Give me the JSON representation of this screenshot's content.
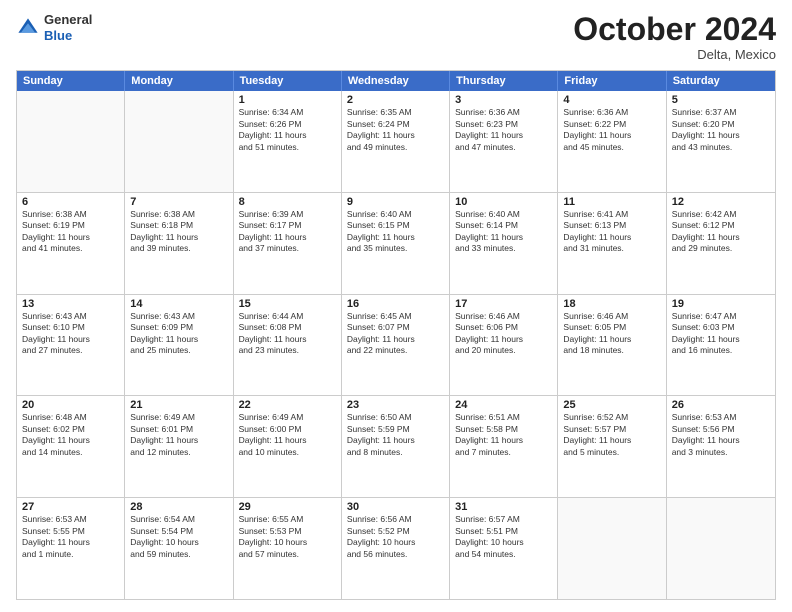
{
  "logo": {
    "line1": "General",
    "line2": "Blue"
  },
  "header": {
    "month": "October 2024",
    "location": "Delta, Mexico"
  },
  "days_of_week": [
    "Sunday",
    "Monday",
    "Tuesday",
    "Wednesday",
    "Thursday",
    "Friday",
    "Saturday"
  ],
  "weeks": [
    [
      {
        "day": "",
        "empty": true
      },
      {
        "day": "",
        "empty": true
      },
      {
        "day": "1",
        "line1": "Sunrise: 6:34 AM",
        "line2": "Sunset: 6:26 PM",
        "line3": "Daylight: 11 hours",
        "line4": "and 51 minutes."
      },
      {
        "day": "2",
        "line1": "Sunrise: 6:35 AM",
        "line2": "Sunset: 6:24 PM",
        "line3": "Daylight: 11 hours",
        "line4": "and 49 minutes."
      },
      {
        "day": "3",
        "line1": "Sunrise: 6:36 AM",
        "line2": "Sunset: 6:23 PM",
        "line3": "Daylight: 11 hours",
        "line4": "and 47 minutes."
      },
      {
        "day": "4",
        "line1": "Sunrise: 6:36 AM",
        "line2": "Sunset: 6:22 PM",
        "line3": "Daylight: 11 hours",
        "line4": "and 45 minutes."
      },
      {
        "day": "5",
        "line1": "Sunrise: 6:37 AM",
        "line2": "Sunset: 6:20 PM",
        "line3": "Daylight: 11 hours",
        "line4": "and 43 minutes."
      }
    ],
    [
      {
        "day": "6",
        "line1": "Sunrise: 6:38 AM",
        "line2": "Sunset: 6:19 PM",
        "line3": "Daylight: 11 hours",
        "line4": "and 41 minutes."
      },
      {
        "day": "7",
        "line1": "Sunrise: 6:38 AM",
        "line2": "Sunset: 6:18 PM",
        "line3": "Daylight: 11 hours",
        "line4": "and 39 minutes."
      },
      {
        "day": "8",
        "line1": "Sunrise: 6:39 AM",
        "line2": "Sunset: 6:17 PM",
        "line3": "Daylight: 11 hours",
        "line4": "and 37 minutes."
      },
      {
        "day": "9",
        "line1": "Sunrise: 6:40 AM",
        "line2": "Sunset: 6:15 PM",
        "line3": "Daylight: 11 hours",
        "line4": "and 35 minutes."
      },
      {
        "day": "10",
        "line1": "Sunrise: 6:40 AM",
        "line2": "Sunset: 6:14 PM",
        "line3": "Daylight: 11 hours",
        "line4": "and 33 minutes."
      },
      {
        "day": "11",
        "line1": "Sunrise: 6:41 AM",
        "line2": "Sunset: 6:13 PM",
        "line3": "Daylight: 11 hours",
        "line4": "and 31 minutes."
      },
      {
        "day": "12",
        "line1": "Sunrise: 6:42 AM",
        "line2": "Sunset: 6:12 PM",
        "line3": "Daylight: 11 hours",
        "line4": "and 29 minutes."
      }
    ],
    [
      {
        "day": "13",
        "line1": "Sunrise: 6:43 AM",
        "line2": "Sunset: 6:10 PM",
        "line3": "Daylight: 11 hours",
        "line4": "and 27 minutes."
      },
      {
        "day": "14",
        "line1": "Sunrise: 6:43 AM",
        "line2": "Sunset: 6:09 PM",
        "line3": "Daylight: 11 hours",
        "line4": "and 25 minutes."
      },
      {
        "day": "15",
        "line1": "Sunrise: 6:44 AM",
        "line2": "Sunset: 6:08 PM",
        "line3": "Daylight: 11 hours",
        "line4": "and 23 minutes."
      },
      {
        "day": "16",
        "line1": "Sunrise: 6:45 AM",
        "line2": "Sunset: 6:07 PM",
        "line3": "Daylight: 11 hours",
        "line4": "and 22 minutes."
      },
      {
        "day": "17",
        "line1": "Sunrise: 6:46 AM",
        "line2": "Sunset: 6:06 PM",
        "line3": "Daylight: 11 hours",
        "line4": "and 20 minutes."
      },
      {
        "day": "18",
        "line1": "Sunrise: 6:46 AM",
        "line2": "Sunset: 6:05 PM",
        "line3": "Daylight: 11 hours",
        "line4": "and 18 minutes."
      },
      {
        "day": "19",
        "line1": "Sunrise: 6:47 AM",
        "line2": "Sunset: 6:03 PM",
        "line3": "Daylight: 11 hours",
        "line4": "and 16 minutes."
      }
    ],
    [
      {
        "day": "20",
        "line1": "Sunrise: 6:48 AM",
        "line2": "Sunset: 6:02 PM",
        "line3": "Daylight: 11 hours",
        "line4": "and 14 minutes."
      },
      {
        "day": "21",
        "line1": "Sunrise: 6:49 AM",
        "line2": "Sunset: 6:01 PM",
        "line3": "Daylight: 11 hours",
        "line4": "and 12 minutes."
      },
      {
        "day": "22",
        "line1": "Sunrise: 6:49 AM",
        "line2": "Sunset: 6:00 PM",
        "line3": "Daylight: 11 hours",
        "line4": "and 10 minutes."
      },
      {
        "day": "23",
        "line1": "Sunrise: 6:50 AM",
        "line2": "Sunset: 5:59 PM",
        "line3": "Daylight: 11 hours",
        "line4": "and 8 minutes."
      },
      {
        "day": "24",
        "line1": "Sunrise: 6:51 AM",
        "line2": "Sunset: 5:58 PM",
        "line3": "Daylight: 11 hours",
        "line4": "and 7 minutes."
      },
      {
        "day": "25",
        "line1": "Sunrise: 6:52 AM",
        "line2": "Sunset: 5:57 PM",
        "line3": "Daylight: 11 hours",
        "line4": "and 5 minutes."
      },
      {
        "day": "26",
        "line1": "Sunrise: 6:53 AM",
        "line2": "Sunset: 5:56 PM",
        "line3": "Daylight: 11 hours",
        "line4": "and 3 minutes."
      }
    ],
    [
      {
        "day": "27",
        "line1": "Sunrise: 6:53 AM",
        "line2": "Sunset: 5:55 PM",
        "line3": "Daylight: 11 hours",
        "line4": "and 1 minute."
      },
      {
        "day": "28",
        "line1": "Sunrise: 6:54 AM",
        "line2": "Sunset: 5:54 PM",
        "line3": "Daylight: 10 hours",
        "line4": "and 59 minutes."
      },
      {
        "day": "29",
        "line1": "Sunrise: 6:55 AM",
        "line2": "Sunset: 5:53 PM",
        "line3": "Daylight: 10 hours",
        "line4": "and 57 minutes."
      },
      {
        "day": "30",
        "line1": "Sunrise: 6:56 AM",
        "line2": "Sunset: 5:52 PM",
        "line3": "Daylight: 10 hours",
        "line4": "and 56 minutes."
      },
      {
        "day": "31",
        "line1": "Sunrise: 6:57 AM",
        "line2": "Sunset: 5:51 PM",
        "line3": "Daylight: 10 hours",
        "line4": "and 54 minutes."
      },
      {
        "day": "",
        "empty": true
      },
      {
        "day": "",
        "empty": true
      }
    ]
  ]
}
